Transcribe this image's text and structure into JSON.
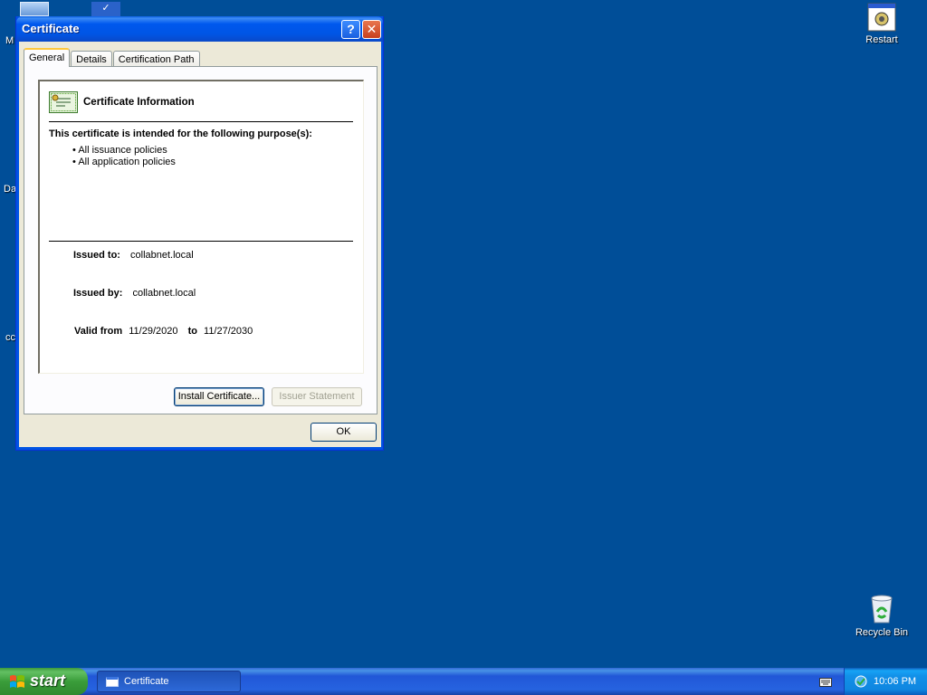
{
  "desktop": {
    "icons": [
      {
        "name": "restart-icon",
        "label": "Restart"
      },
      {
        "name": "recycle-bin-icon",
        "label": "Recycle Bin"
      }
    ],
    "partial_labels": [
      "M",
      "Da",
      "cc"
    ]
  },
  "window": {
    "title": "Certificate",
    "tabs": [
      {
        "label": "General",
        "active": true
      },
      {
        "label": "Details",
        "active": false
      },
      {
        "label": "Certification Path",
        "active": false
      }
    ],
    "info": {
      "header": "Certificate Information",
      "purpose_heading": "This certificate is intended for the following purpose(s):",
      "purposes": [
        "All issuance policies",
        "All application policies"
      ],
      "issued_to_label": "Issued to:",
      "issued_to": "collabnet.local",
      "issued_by_label": "Issued by:",
      "issued_by": "collabnet.local",
      "valid_from_label": "Valid from",
      "valid_from": "11/29/2020",
      "to_label": "to",
      "valid_to": "11/27/2030"
    },
    "buttons": {
      "install": "Install Certificate...",
      "issuer_statement": "Issuer Statement",
      "ok": "OK"
    }
  },
  "taskbar": {
    "start_label": "start",
    "task_item": "Certificate",
    "clock": "10:06 PM"
  },
  "colors": {
    "desktop": "#004e98",
    "titlebar": "#0055e5",
    "window_face": "#ece9d8"
  }
}
